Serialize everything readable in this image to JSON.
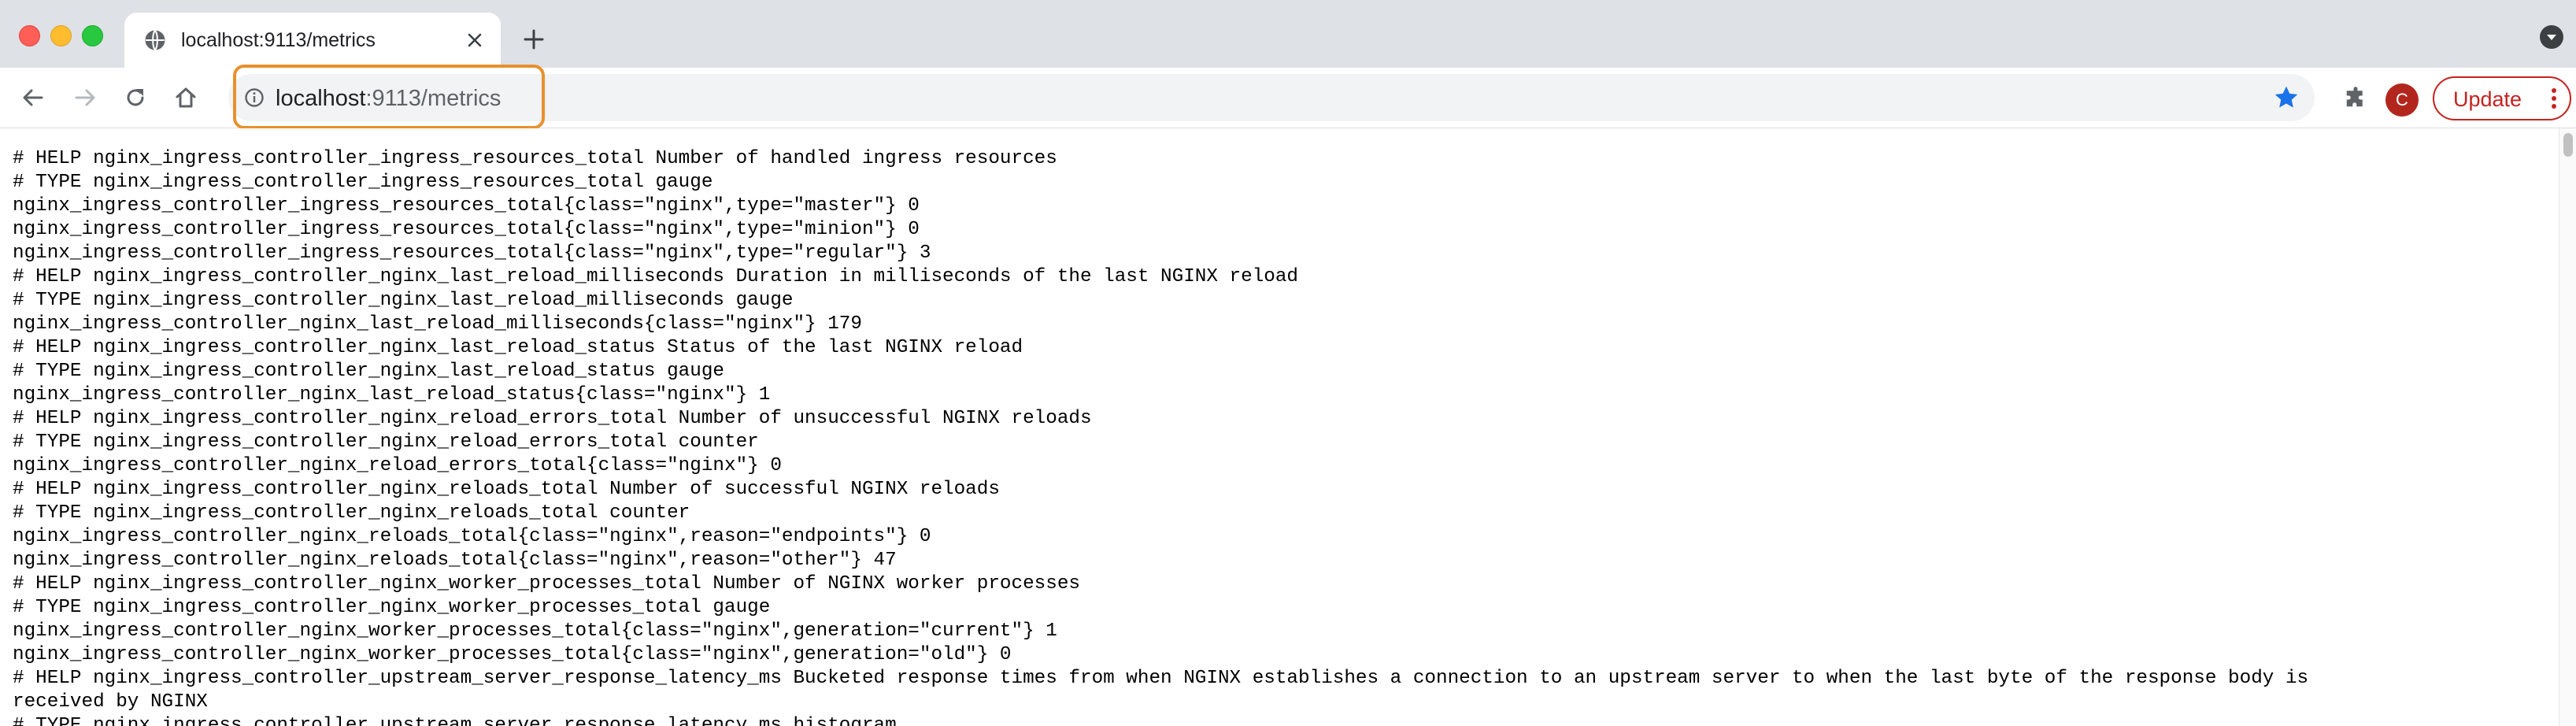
{
  "tab": {
    "title": "localhost:9113/metrics",
    "favicon": "globe-icon",
    "close_icon": "close-icon"
  },
  "tabstrip": {
    "new_tab_icon": "plus-icon",
    "tab_search_icon": "chevron-down-icon"
  },
  "toolbar": {
    "back_icon": "arrow-left-icon",
    "forward_icon": "arrow-right-icon",
    "reload_icon": "reload-icon",
    "home_icon": "home-icon",
    "extensions_icon": "puzzle-icon",
    "profile_initial": "C",
    "update_label": "Update",
    "menu_icon": "kebab-menu-icon"
  },
  "omnibox": {
    "host": "localhost",
    "rest": ":9113/metrics",
    "info_icon": "info-icon",
    "bookmark_icon": "star-icon"
  },
  "colors": {
    "tab_strip": "#dee1e6",
    "omnibox_bg": "#f1f3f4",
    "focus_ring": "#e8902d",
    "bookmark_star": "#1a73e8",
    "update_red": "#c5221f",
    "avatar": "#b3261e"
  },
  "content": {
    "lines": [
      "# HELP nginx_ingress_controller_ingress_resources_total Number of handled ingress resources",
      "# TYPE nginx_ingress_controller_ingress_resources_total gauge",
      "nginx_ingress_controller_ingress_resources_total{class=\"nginx\",type=\"master\"} 0",
      "nginx_ingress_controller_ingress_resources_total{class=\"nginx\",type=\"minion\"} 0",
      "nginx_ingress_controller_ingress_resources_total{class=\"nginx\",type=\"regular\"} 3",
      "# HELP nginx_ingress_controller_nginx_last_reload_milliseconds Duration in milliseconds of the last NGINX reload",
      "# TYPE nginx_ingress_controller_nginx_last_reload_milliseconds gauge",
      "nginx_ingress_controller_nginx_last_reload_milliseconds{class=\"nginx\"} 179",
      "# HELP nginx_ingress_controller_nginx_last_reload_status Status of the last NGINX reload",
      "# TYPE nginx_ingress_controller_nginx_last_reload_status gauge",
      "nginx_ingress_controller_nginx_last_reload_status{class=\"nginx\"} 1",
      "# HELP nginx_ingress_controller_nginx_reload_errors_total Number of unsuccessful NGINX reloads",
      "# TYPE nginx_ingress_controller_nginx_reload_errors_total counter",
      "nginx_ingress_controller_nginx_reload_errors_total{class=\"nginx\"} 0",
      "# HELP nginx_ingress_controller_nginx_reloads_total Number of successful NGINX reloads",
      "# TYPE nginx_ingress_controller_nginx_reloads_total counter",
      "nginx_ingress_controller_nginx_reloads_total{class=\"nginx\",reason=\"endpoints\"} 0",
      "nginx_ingress_controller_nginx_reloads_total{class=\"nginx\",reason=\"other\"} 47",
      "# HELP nginx_ingress_controller_nginx_worker_processes_total Number of NGINX worker processes",
      "# TYPE nginx_ingress_controller_nginx_worker_processes_total gauge",
      "nginx_ingress_controller_nginx_worker_processes_total{class=\"nginx\",generation=\"current\"} 1",
      "nginx_ingress_controller_nginx_worker_processes_total{class=\"nginx\",generation=\"old\"} 0",
      "# HELP nginx_ingress_controller_upstream_server_response_latency_ms Bucketed response times from when NGINX establishes a connection to an upstream server to when the last byte of the response body is",
      "received by NGINX",
      "# TYPE nginx_ingress_controller_upstream_server_response_latency_ms histogram"
    ]
  }
}
